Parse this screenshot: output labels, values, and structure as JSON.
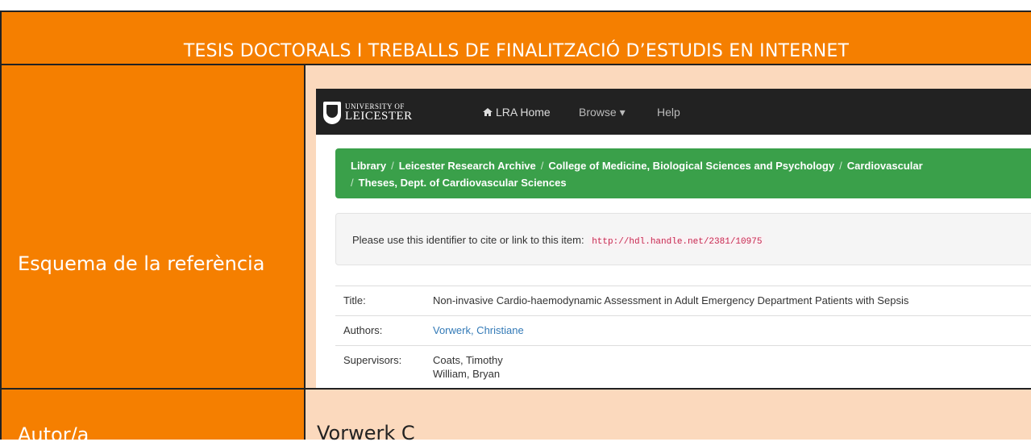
{
  "header": {
    "title": "TESIS DOCTORALS I TREBALLS DE FINALITZACIÓ D’ESTUDIS EN INTERNET"
  },
  "rows": [
    {
      "label": "Esquema de la referència"
    },
    {
      "label": "Autor/a",
      "value": "Vorwerk C"
    }
  ],
  "screenshot": {
    "logo": {
      "line1": "UNIVERSITY OF",
      "line2": "LEICESTER"
    },
    "nav": {
      "home": "LRA Home",
      "browse": "Browse ▾",
      "help": "Help"
    },
    "breadcrumb": {
      "line1": [
        "Library",
        "Leicester Research Archive",
        "College of Medicine, Biological Sciences and Psychology",
        "Cardiovascular"
      ],
      "line2": [
        "Theses, Dept. of Cardiovascular Sciences"
      ]
    },
    "cite": {
      "text": "Please use this identifier to cite or link to this item:",
      "url": "http://hdl.handle.net/2381/10975"
    },
    "metadata": {
      "title_label": "Title:",
      "title_value": "Non-invasive Cardio-haemodynamic Assessment in Adult Emergency Department Patients with Sepsis",
      "authors_label": "Authors:",
      "authors_value": "Vorwerk, Christiane",
      "supervisors_label": "Supervisors:",
      "supervisors_values": [
        "Coats, Timothy",
        "William, Bryan"
      ]
    }
  },
  "colors": {
    "orange": "#f57f00",
    "peach": "#fbd9bd",
    "navbar": "#222222",
    "breadcrumb_green": "#3aa04a",
    "link": "#337ab7"
  }
}
